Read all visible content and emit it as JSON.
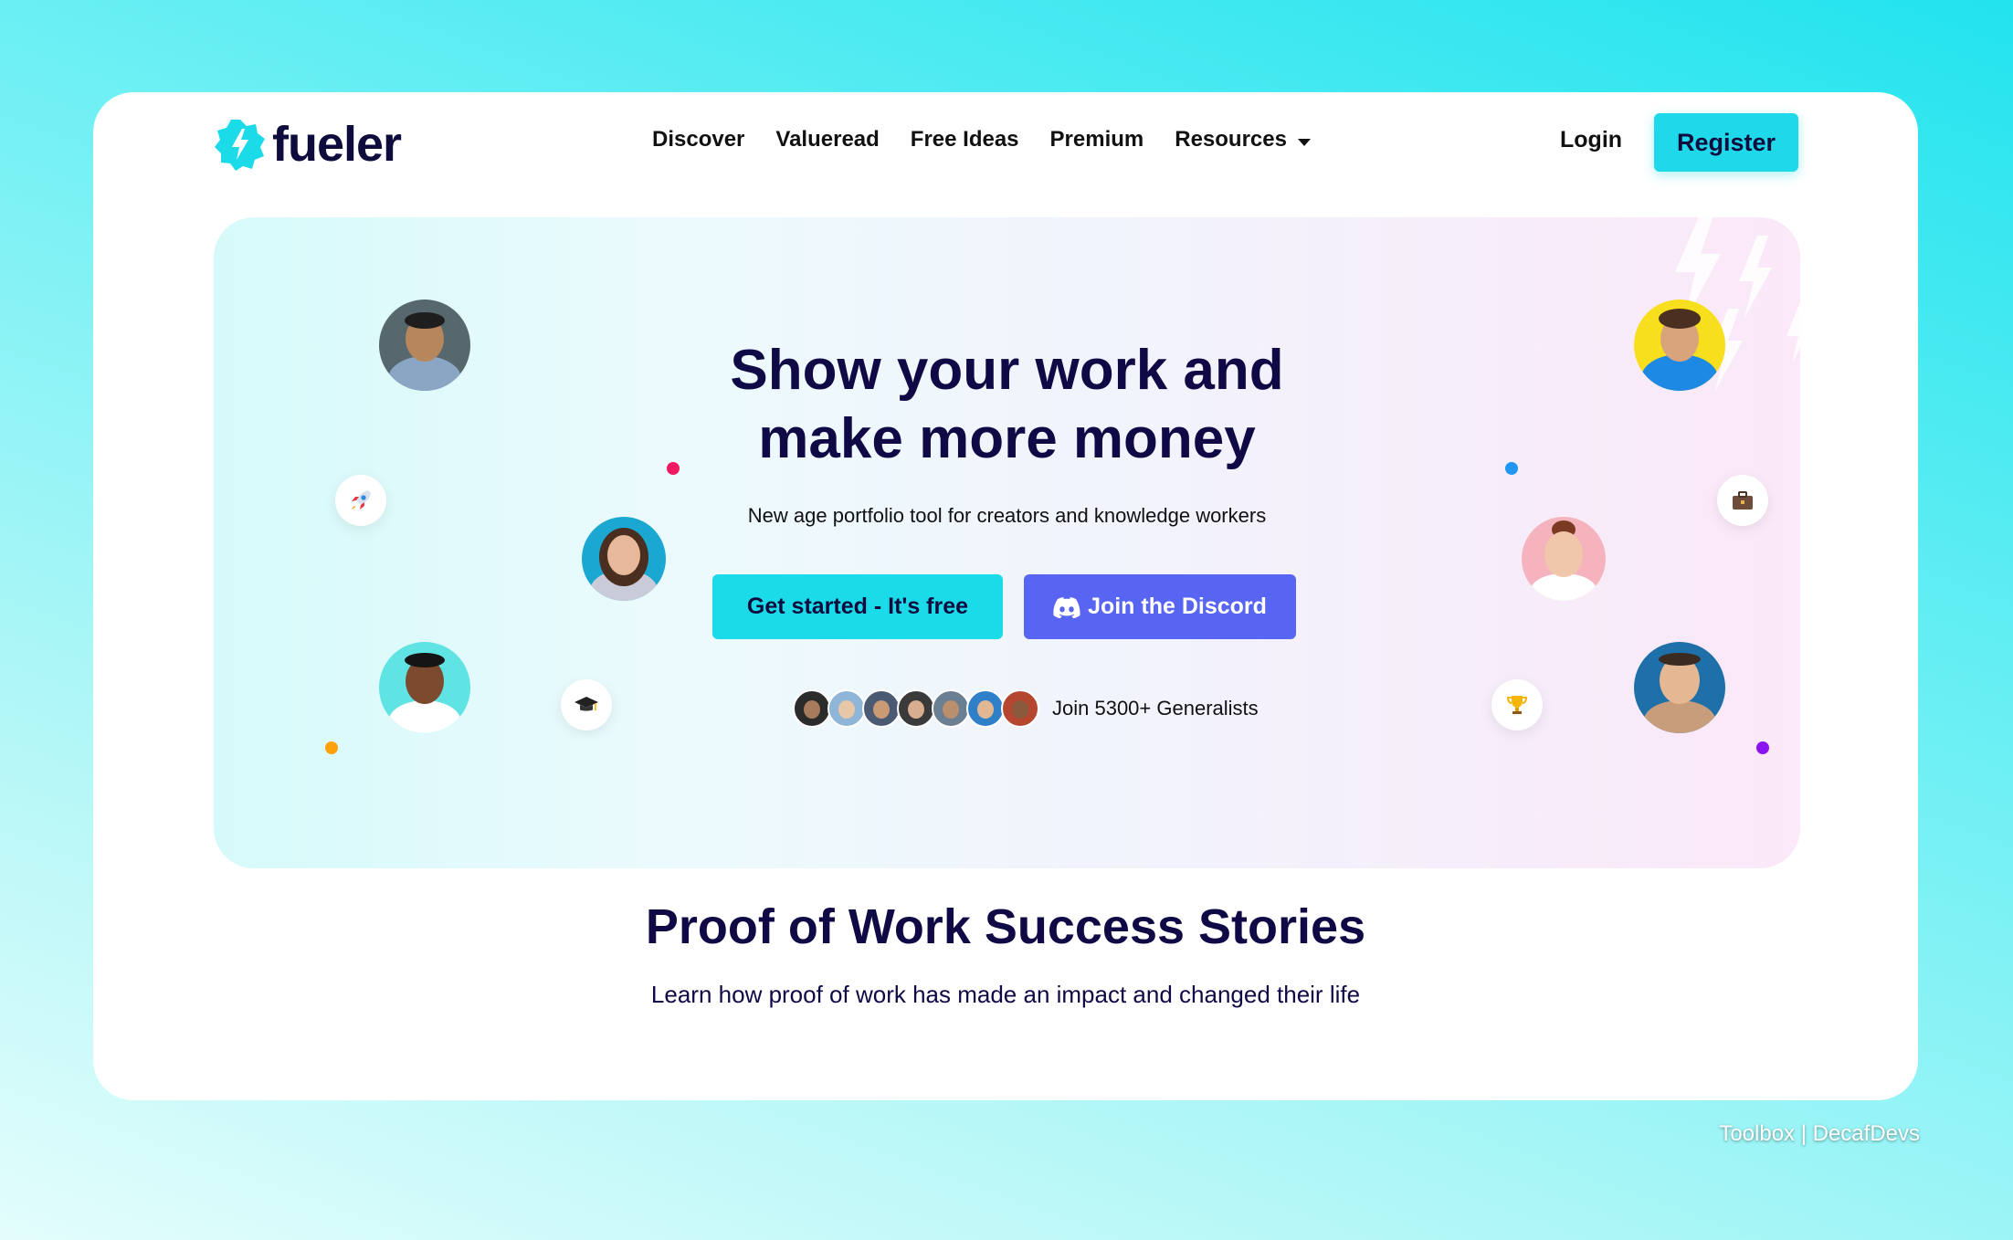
{
  "brand": {
    "name": "fueler",
    "accent": "#1fd9ea",
    "dark": "#0f0a45"
  },
  "nav": {
    "links": [
      "Discover",
      "Valueread",
      "Free Ideas",
      "Premium",
      "Resources"
    ],
    "login": "Login",
    "register": "Register"
  },
  "hero": {
    "title_line1": "Show your work and",
    "title_line2": "make more money",
    "subtitle": "New age portfolio tool for creators and knowledge workers",
    "cta_primary": "Get started - It's free",
    "cta_secondary": "Join the Discord",
    "community_text": "Join 5300+ Generalists",
    "floating_icons": [
      "rocket-icon",
      "graduation-cap-icon",
      "briefcase-icon",
      "trophy-icon"
    ]
  },
  "stories": {
    "title": "Proof of Work Success Stories",
    "subtitle": "Learn how proof of work has made an impact and changed their life"
  },
  "watermark": "Toolbox | DecafDevs",
  "colors": {
    "discord": "#5865f2",
    "dot_pink": "#f0195f",
    "dot_blue": "#2196f3",
    "dot_orange": "#ffa20a",
    "dot_purple": "#8a13f0"
  }
}
